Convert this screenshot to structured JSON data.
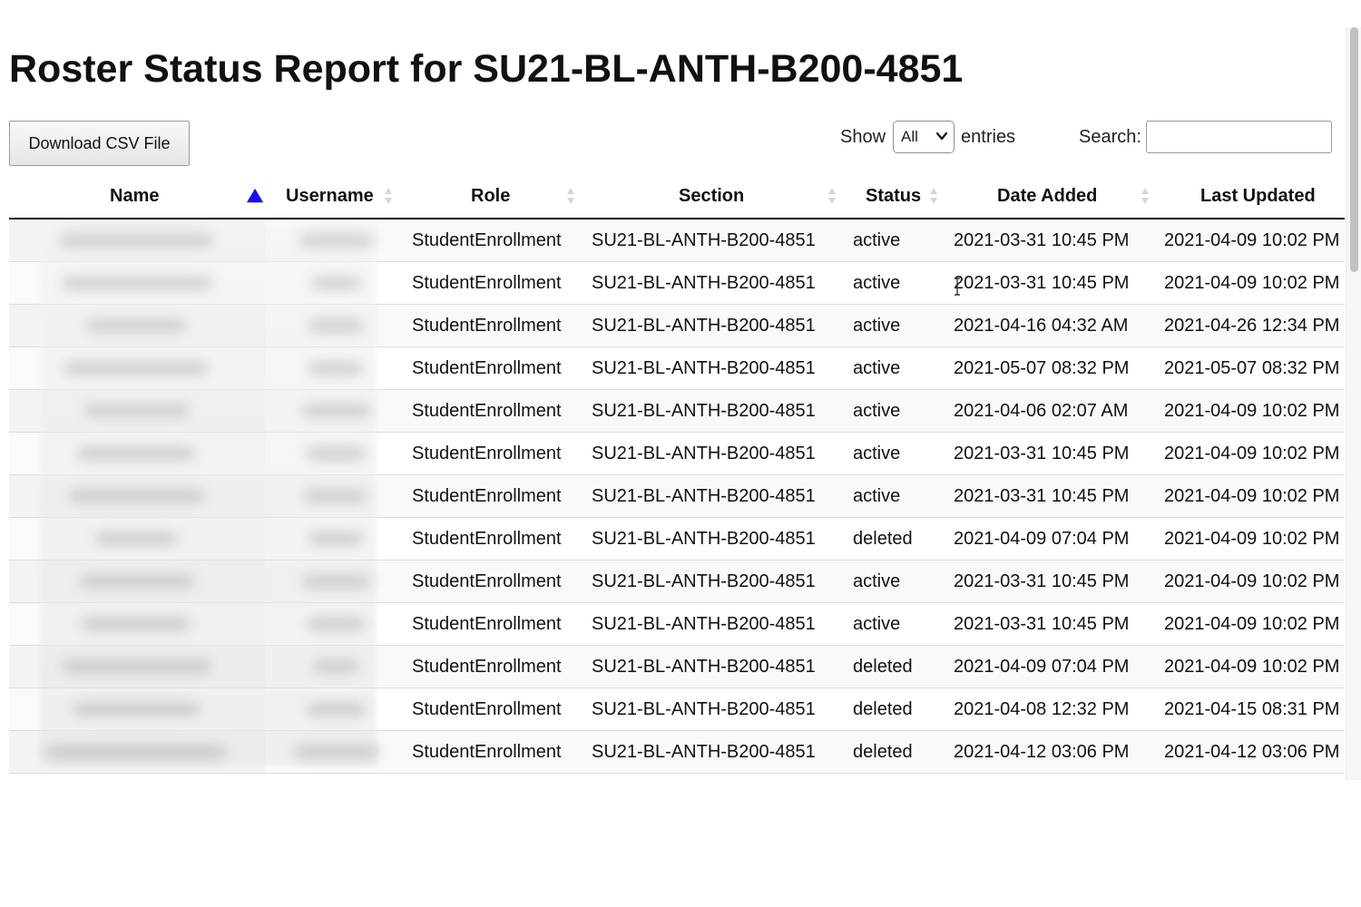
{
  "page": {
    "title": "Roster Status Report for SU21-BL-ANTH-B200-4851"
  },
  "toolbar": {
    "download_label": "Download CSV File",
    "show_label": "Show",
    "entries_selected": "All",
    "entries_label": "entries",
    "search_label": "Search:",
    "search_value": ""
  },
  "table": {
    "columns": [
      {
        "label": "Name",
        "sort": "ascending"
      },
      {
        "label": "Username",
        "sort": "none"
      },
      {
        "label": "Role",
        "sort": "none"
      },
      {
        "label": "Section",
        "sort": "none"
      },
      {
        "label": "Status",
        "sort": "none"
      },
      {
        "label": "Date Added",
        "sort": "none"
      },
      {
        "label": "Last Updated",
        "sort": "none"
      }
    ],
    "rows": [
      {
        "role": "StudentEnrollment",
        "section": "SU21-BL-ANTH-B200-4851",
        "status": "active",
        "date_added": "2021-03-31 10:45 PM",
        "last_updated": "2021-04-09 10:02 PM"
      },
      {
        "role": "StudentEnrollment",
        "section": "SU21-BL-ANTH-B200-4851",
        "status": "active",
        "date_added": "2021-03-31 10:45 PM",
        "last_updated": "2021-04-09 10:02 PM"
      },
      {
        "role": "StudentEnrollment",
        "section": "SU21-BL-ANTH-B200-4851",
        "status": "active",
        "date_added": "2021-04-16 04:32 AM",
        "last_updated": "2021-04-26 12:34 PM"
      },
      {
        "role": "StudentEnrollment",
        "section": "SU21-BL-ANTH-B200-4851",
        "status": "active",
        "date_added": "2021-05-07 08:32 PM",
        "last_updated": "2021-05-07 08:32 PM"
      },
      {
        "role": "StudentEnrollment",
        "section": "SU21-BL-ANTH-B200-4851",
        "status": "active",
        "date_added": "2021-04-06 02:07 AM",
        "last_updated": "2021-04-09 10:02 PM"
      },
      {
        "role": "StudentEnrollment",
        "section": "SU21-BL-ANTH-B200-4851",
        "status": "active",
        "date_added": "2021-03-31 10:45 PM",
        "last_updated": "2021-04-09 10:02 PM"
      },
      {
        "role": "StudentEnrollment",
        "section": "SU21-BL-ANTH-B200-4851",
        "status": "active",
        "date_added": "2021-03-31 10:45 PM",
        "last_updated": "2021-04-09 10:02 PM"
      },
      {
        "role": "StudentEnrollment",
        "section": "SU21-BL-ANTH-B200-4851",
        "status": "deleted",
        "date_added": "2021-04-09 07:04 PM",
        "last_updated": "2021-04-09 10:02 PM"
      },
      {
        "role": "StudentEnrollment",
        "section": "SU21-BL-ANTH-B200-4851",
        "status": "active",
        "date_added": "2021-03-31 10:45 PM",
        "last_updated": "2021-04-09 10:02 PM"
      },
      {
        "role": "StudentEnrollment",
        "section": "SU21-BL-ANTH-B200-4851",
        "status": "active",
        "date_added": "2021-03-31 10:45 PM",
        "last_updated": "2021-04-09 10:02 PM"
      },
      {
        "role": "StudentEnrollment",
        "section": "SU21-BL-ANTH-B200-4851",
        "status": "deleted",
        "date_added": "2021-04-09 07:04 PM",
        "last_updated": "2021-04-09 10:02 PM"
      },
      {
        "role": "StudentEnrollment",
        "section": "SU21-BL-ANTH-B200-4851",
        "status": "deleted",
        "date_added": "2021-04-08 12:32 PM",
        "last_updated": "2021-04-15 08:31 PM"
      },
      {
        "role": "StudentEnrollment",
        "section": "SU21-BL-ANTH-B200-4851",
        "status": "deleted",
        "date_added": "2021-04-12 03:06 PM",
        "last_updated": "2021-04-12 03:06 PM"
      }
    ]
  },
  "icons": {
    "sort_active": "sort-ascending-icon",
    "sort_idle": "sort-both-icon",
    "select": "chevron-down-icon",
    "cursor": "text-cursor-icon"
  },
  "colors": {
    "sort_active": "#1a0dff",
    "sort_idle": "#d6d6d6",
    "header_rule": "#111111"
  }
}
